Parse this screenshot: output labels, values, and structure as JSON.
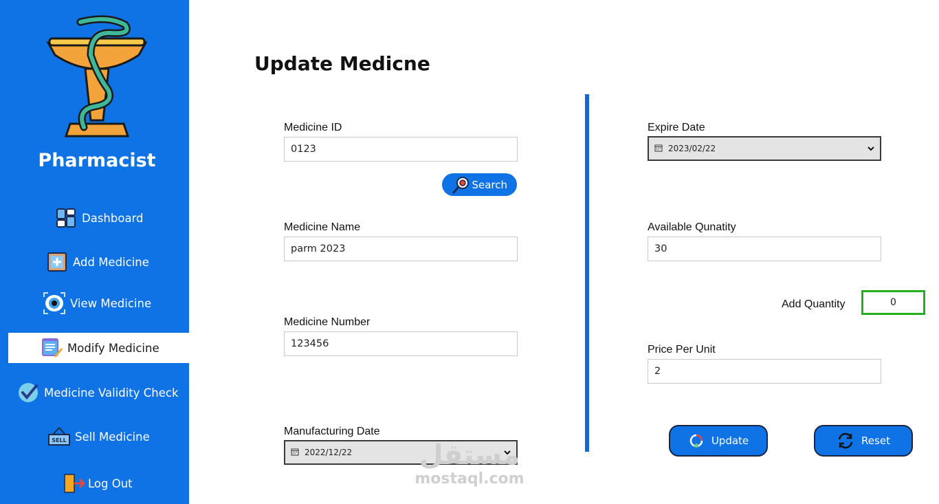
{
  "sidebar": {
    "role": "Pharmacist",
    "items": [
      {
        "label": "Dashboard",
        "icon": "dashboard-icon"
      },
      {
        "label": "Add Medicine",
        "icon": "add-medicine-icon"
      },
      {
        "label": "View Medicine",
        "icon": "eye-icon"
      },
      {
        "label": "Modify Medicine",
        "icon": "edit-list-icon",
        "active": true
      },
      {
        "label": "Medicine Validity Check",
        "icon": "check-circle-icon"
      },
      {
        "label": "Sell Medicine",
        "icon": "sell-sign-icon"
      },
      {
        "label": "Log Out",
        "icon": "logout-door-icon"
      }
    ]
  },
  "main": {
    "title": "Update Medicne",
    "medicine_id": {
      "label": "Medicine ID",
      "value": "0123"
    },
    "search_label": "Search",
    "medicine_name": {
      "label": "Medicine Name",
      "value": "parm 2023"
    },
    "medicine_number": {
      "label": "Medicine Number",
      "value": "123456"
    },
    "manufacturing_date": {
      "label": "Manufacturing Date",
      "value": "2022/12/22"
    },
    "expire_date": {
      "label": "Expire Date",
      "value": "2023/02/22"
    },
    "available_quantity": {
      "label": "Available Qunatity",
      "value": "30"
    },
    "add_quantity": {
      "label": "Add Quantity",
      "value": "0"
    },
    "price_per_unit": {
      "label": "Price Per Unit",
      "value": "2"
    },
    "update_label": "Update",
    "reset_label": "Reset"
  },
  "watermark": {
    "arabic": "مستقل",
    "text": "mostaql.com"
  },
  "colors": {
    "sidebar": "#0f72e5",
    "accent_border": "#22b01f",
    "divider": "#1168d6"
  }
}
